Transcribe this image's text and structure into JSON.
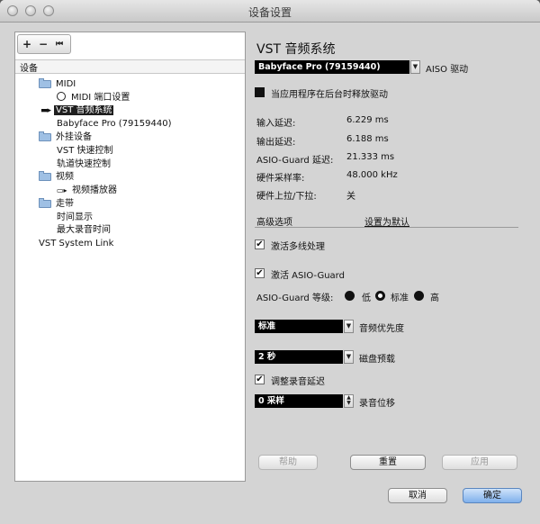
{
  "window": {
    "title": "设备设置"
  },
  "left_toolbar": {
    "add": "+",
    "remove": "−",
    "reset": "⏮"
  },
  "tree": {
    "header": "设备",
    "items": [
      {
        "label": "MIDI",
        "icon": "folder-icon"
      },
      {
        "label": "MIDI 端口设置",
        "icon": "midi-port-icon"
      },
      {
        "label": "VST 音频系统",
        "icon": "audio-icon"
      },
      {
        "label": "Babyface Pro (79159440)"
      },
      {
        "label": "外挂设备",
        "icon": "folder-icon"
      },
      {
        "label": "VST 快速控制"
      },
      {
        "label": "轨道快速控制"
      },
      {
        "label": "视频",
        "icon": "folder-icon"
      },
      {
        "label": "视频播放器",
        "icon": "video-icon"
      },
      {
        "label": "走带",
        "icon": "folder-icon"
      },
      {
        "label": "时间显示"
      },
      {
        "label": "最大录音时间"
      },
      {
        "label": "VST System Link"
      }
    ]
  },
  "panel": {
    "title": "VST 音频系统",
    "driver_select": "Babyface Pro (79159440)",
    "driver_type": "AISO 驱动",
    "release_driver_label": "当应用程序在后台时释放驱动",
    "info": [
      {
        "label": "输入延迟:",
        "value": "6.229 ms"
      },
      {
        "label": "输出延迟:",
        "value": "6.188 ms"
      },
      {
        "label": "ASIO-Guard 延迟:",
        "value": "21.333 ms"
      },
      {
        "label": "硬件采样率:",
        "value": "48.000 kHz"
      },
      {
        "label": "硬件上拉/下拉:",
        "value": "关"
      }
    ],
    "advanced_label": "高级选项",
    "reset_defaults": "设置为默认",
    "multiprocessing_label": "激活多线处理",
    "asio_guard_label": "激活 ASIO-Guard",
    "asio_guard_level_label": "ASIO-Guard 等级:",
    "levels": [
      "低",
      "标准",
      "高"
    ],
    "priority_value": "标准",
    "priority_label": "音频优先度",
    "preload_value": "2 秒",
    "preload_label": "磁盘预载",
    "adjust_latency_label": "调整录音延迟",
    "offset_value": "0 采样",
    "offset_label": "录音位移"
  },
  "panel_buttons": {
    "help": "帮助",
    "reset": "重置",
    "apply": "应用"
  },
  "dialog_buttons": {
    "cancel": "取消",
    "ok": "确定"
  }
}
